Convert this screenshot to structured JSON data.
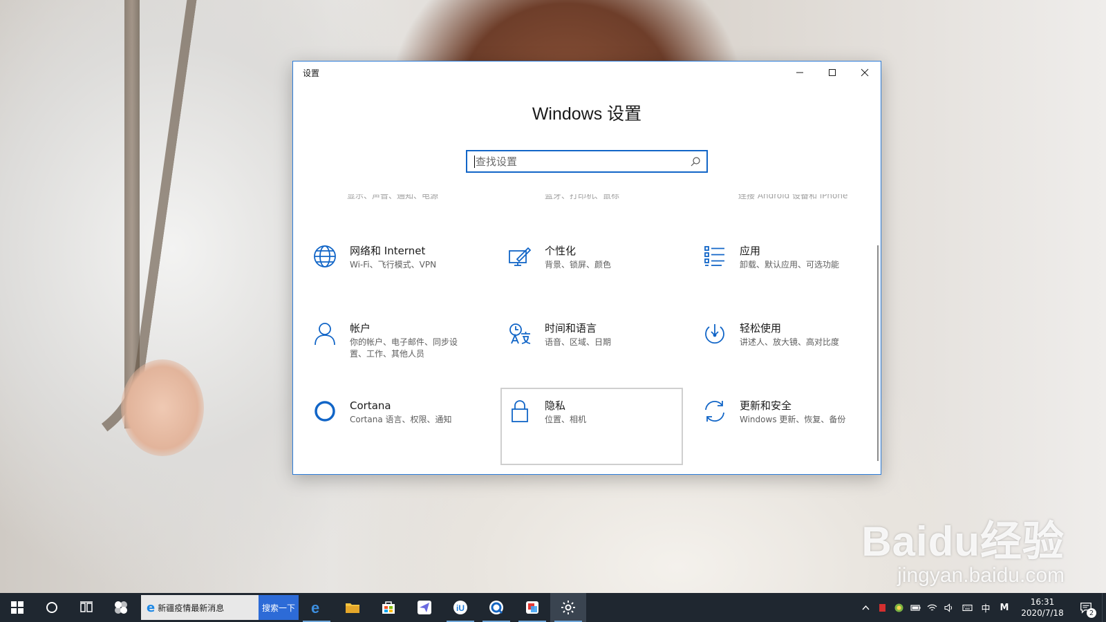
{
  "window": {
    "title": "设置",
    "heading": "Windows 设置",
    "search_placeholder": "查找设置"
  },
  "ghost_row": [
    "显示、声音、通知、电源",
    "蓝牙、打印机、鼠标",
    "连接 Android 设备和 iPhone"
  ],
  "tiles": [
    {
      "name": "网络和 Internet",
      "desc": "Wi-Fi、飞行模式、VPN",
      "icon": "globe-icon"
    },
    {
      "name": "个性化",
      "desc": "背景、锁屏、颜色",
      "icon": "personalization-icon"
    },
    {
      "name": "应用",
      "desc": "卸载、默认应用、可选功能",
      "icon": "apps-list-icon"
    },
    {
      "name": "帐户",
      "desc": "你的帐户、电子邮件、同步设置、工作、其他人员",
      "icon": "person-icon"
    },
    {
      "name": "时间和语言",
      "desc": "语音、区域、日期",
      "icon": "time-language-icon"
    },
    {
      "name": "轻松使用",
      "desc": "讲述人、放大镜、高对比度",
      "icon": "ease-of-access-icon"
    },
    {
      "name": "Cortana",
      "desc": "Cortana 语言、权限、通知",
      "icon": "cortana-ring-icon"
    },
    {
      "name": "隐私",
      "desc": "位置、相机",
      "icon": "lock-icon"
    },
    {
      "name": "更新和安全",
      "desc": "Windows 更新、恢复、备份",
      "icon": "update-arrows-icon"
    }
  ],
  "taskbar": {
    "news_text": "新疆疫情最新消息",
    "search_button": "搜索一下",
    "ime": "中",
    "ime_mode": "M",
    "time": "16:31",
    "date": "2020/7/18",
    "notifications_count": "2"
  },
  "watermark": {
    "logo": "Baidu经验",
    "url": "jingyan.baidu.com"
  },
  "colors": {
    "accent": "#1165c7",
    "taskbar": "#1f2730"
  }
}
